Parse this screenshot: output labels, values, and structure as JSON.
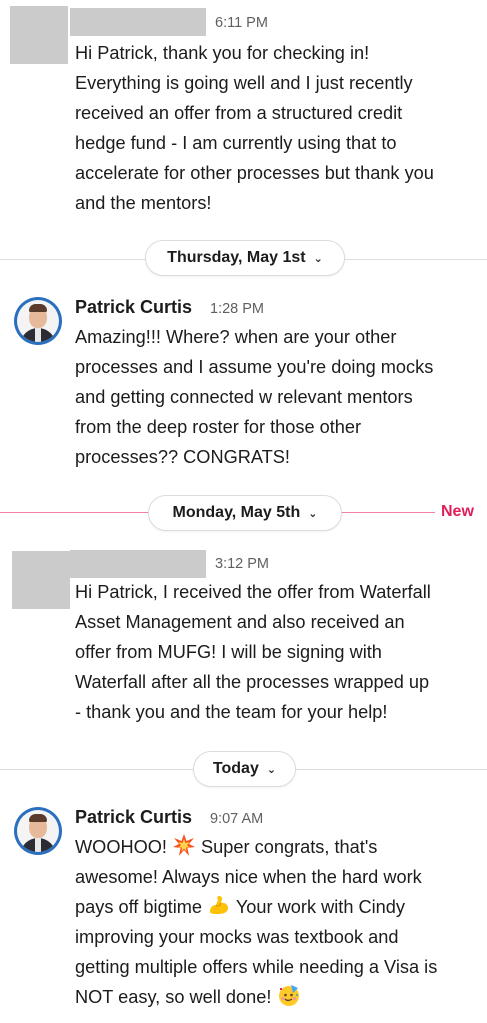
{
  "messages": [
    {
      "id": "m1",
      "sender": "",
      "time": "6:11 PM",
      "text": "Hi Patrick, thank you for checking in!\nEverything is going well and I just recently\nreceived an offer from a structured credit\nhedge fund - I am currently using that to\naccelerate for other processes but thank you\nand the mentors!"
    },
    {
      "id": "m2",
      "sender": "Patrick Curtis",
      "time": "1:28 PM",
      "text": "Amazing!!!  Where?  when are your other\nprocesses and I assume you're doing mocks\nand getting connected w relevant mentors\nfrom the deep roster for those other\nprocesses??    CONGRATS!"
    },
    {
      "id": "m3",
      "sender": "",
      "time": "3:12 PM",
      "text": "Hi Patrick, I received the offer from Waterfall\nAsset Management and also received an\noffer from MUFG! I will be signing with\nWaterfall after all the processes wrapped up\n- thank you and the team for your help!"
    },
    {
      "id": "m4",
      "sender": "Patrick Curtis",
      "time": "9:07 AM",
      "parts": [
        "WOOHOO! ",
        " Super congrats, that's\nawesome!  Always nice when the hard work\npays off bigtime ",
        "  Your work with Cindy\nimproving your mocks was textbook and\ngetting multiple offers while needing a Visa is\nNOT easy, so well done! "
      ],
      "emojis": [
        "collision-emoji",
        "flexed-biceps-emoji",
        "partying-face-emoji"
      ]
    }
  ],
  "dividers": {
    "d1": {
      "label": "Thursday, May 1st"
    },
    "d2": {
      "label": "Monday, May 5th",
      "new_label": "New"
    },
    "d3": {
      "label": "Today"
    }
  },
  "colors": {
    "new_accent": "#e01e5a",
    "avatar_ring": "#2b6fbf",
    "redacted": "#cbcbcb"
  }
}
